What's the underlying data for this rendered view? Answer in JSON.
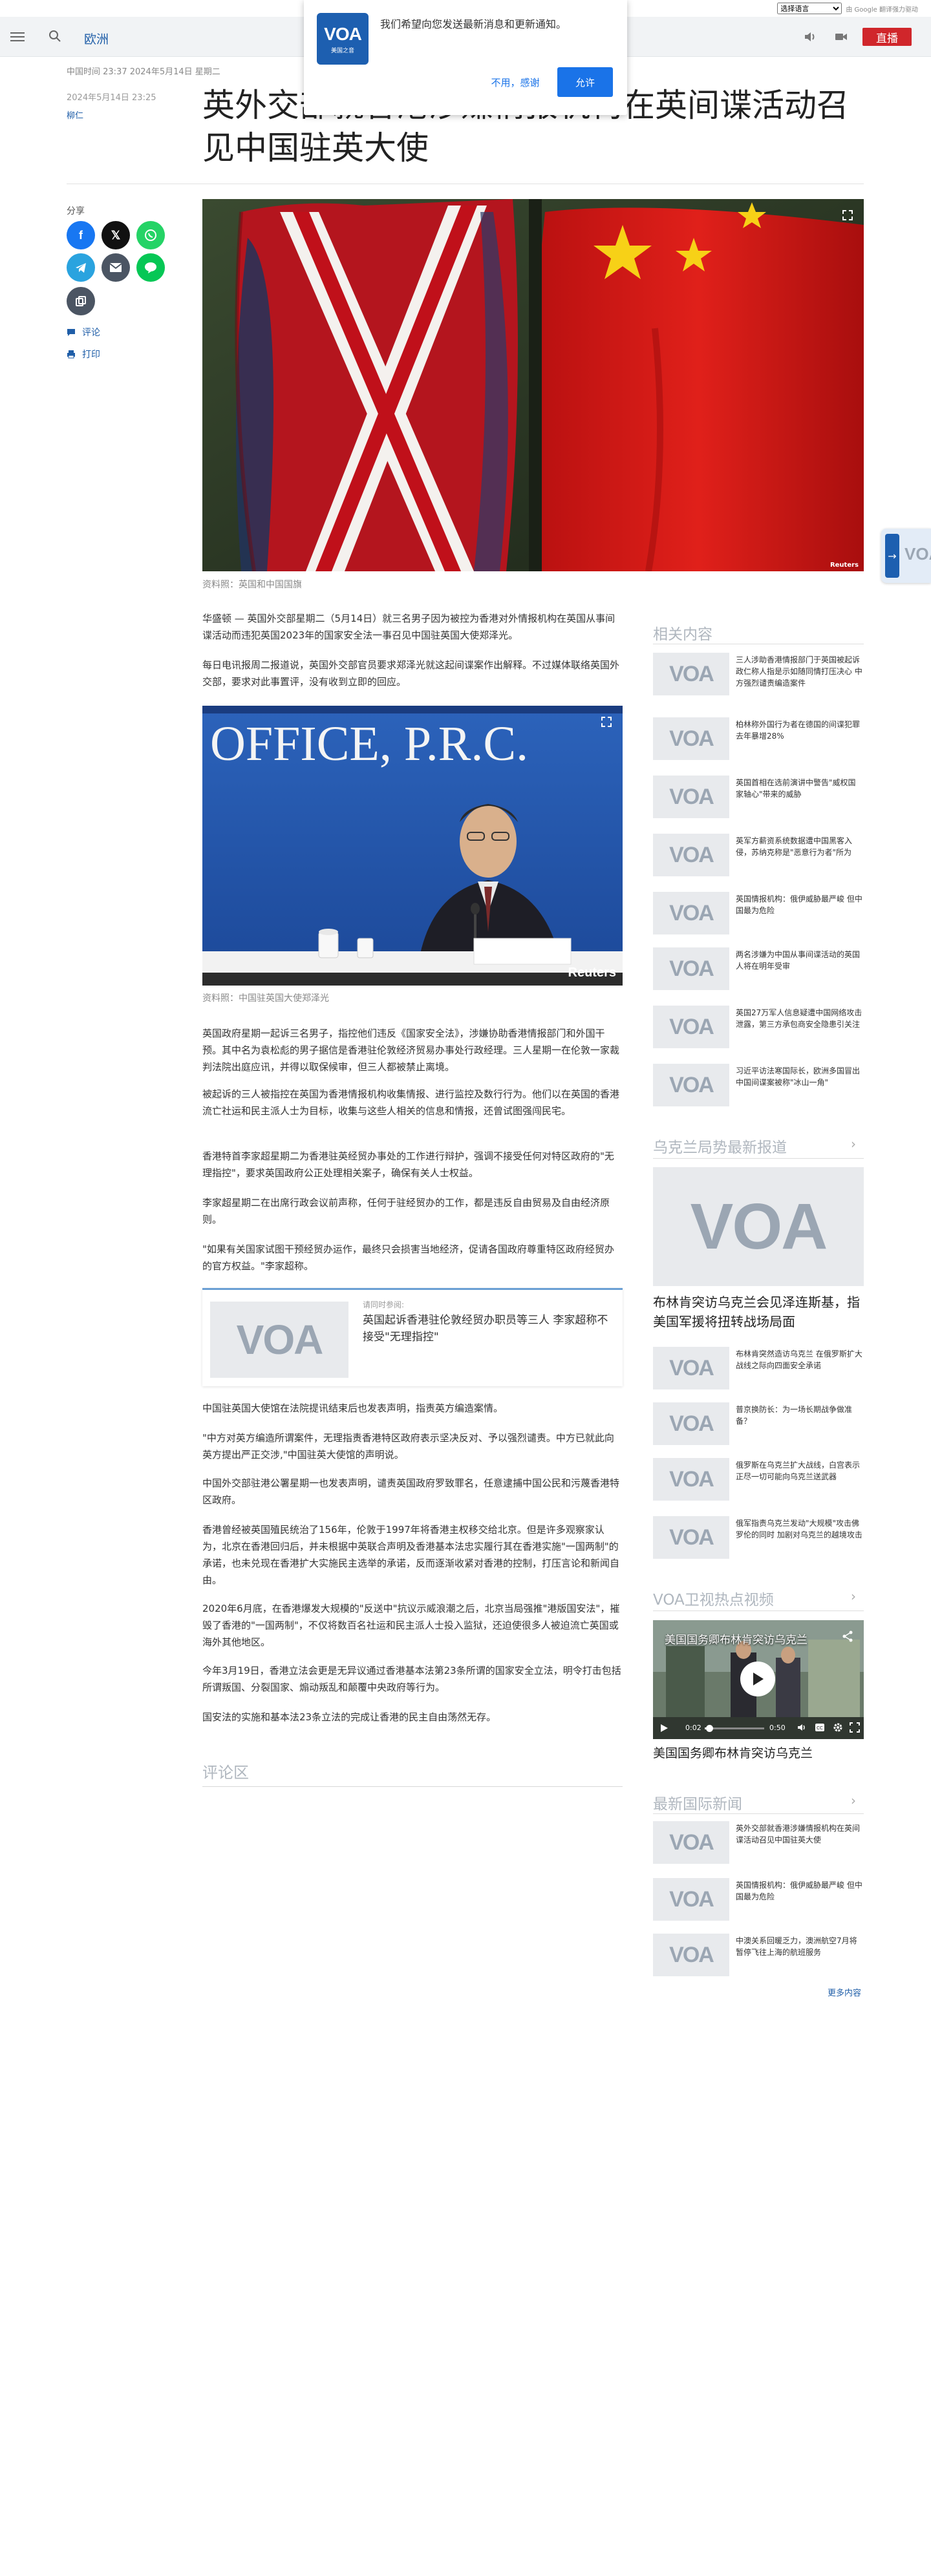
{
  "translate": {
    "select_label": "选择语言",
    "powered_by": "由 Google 翻译强力驱动"
  },
  "header": {
    "section": "欧洲",
    "live_label": "直播"
  },
  "notification": {
    "message": "我们希望向您发送最新消息和更新通知。",
    "deny_label": "不用，感谢",
    "allow_label": "允许",
    "logo_text": "VOA",
    "logo_sub": "美国之音"
  },
  "article": {
    "top_meta": "中国时间 23:37 2024年5月14日 星期二",
    "date": "2024年5月14日 23:25",
    "author": "柳仁",
    "title": "英外交部就香港涉嫌情报机构在英间谍活动召见中国驻英大使",
    "hero_caption": "资料照：英国和中国国旗",
    "hero_credit": "Reuters",
    "paragraphs_a": [
      "华盛顿 — 英国外交部星期二（5月14日）就三名男子因为被控为香港对外情报机构在英国从事间谍活动而违犯英国2023年的国家安全法一事召见中国驻英国大使郑泽光。",
      "每日电讯报周二报道说，英国外交部官员要求郑泽光就这起间谍案作出解释。不过媒体联络英国外交部，要求对此事置评，没有收到立即的回应。"
    ],
    "office_sign": "OFFICE, P.R.C.",
    "office_credit": "Reuters",
    "office_caption": "资料照：中国驻英国大使郑泽光",
    "paragraphs_b": [
      "英国政府星期一起诉三名男子，指控他们违反《国家安全法》，涉嫌协助香港情报部门和外国干预。其中名为袁松彪的男子据信是香港驻伦敦经济贸易办事处行政经理。三人星期一在伦敦一家裁判法院出庭应讯，并得以取保候审，但三人都被禁止离境。",
      "被起诉的三人被指控在英国为香港情报机构收集情报、进行监控及数行行为。他们以在英国的香港流亡社运和民主派人士为目标，收集与这些人相关的信息和情报，还曾试图强闯民宅。",
      "香港特首李家超星期二为香港驻英经贸办事处的工作进行辩护，强调不接受任何对特区政府的\"无理指控\"，要求英国政府公正处理相关案子，确保有关人士权益。",
      "李家超星期二在出席行政会议前声称，任何于驻经贸办的工作，都是违反自由贸易及自由经济原则。",
      "\"如果有关国家试图干预经贸办运作，最终只会损害当地经济，促请各国政府尊重特区政府经贸办的官方权益。\"李家超称。"
    ],
    "read_also_label": "请同时参阅:",
    "read_also_title": "英国起诉香港驻伦敦经贸办职员等三人 李家超称不接受\"无理指控\"",
    "paragraphs_c": [
      "中国驻英国大使馆在法院提讯结束后也发表声明，指责英方编造案情。",
      "\"中方对英方编造所谓案件，无理指责香港特区政府表示坚决反对、予以强烈谴责。中方已就此向英方提出严正交涉,\"中国驻英大使馆的声明说。",
      "中国外交部驻港公署星期一也发表声明，谴责英国政府罗致罪名，任意逮捕中国公民和污蔑香港特区政府。",
      "香港曾经被英国殖民统治了156年，伦敦于1997年将香港主权移交给北京。但是许多观察家认为，北京在香港回归后，并未根据中英联合声明及香港基本法忠实履行其在香港实施\"一国两制\"的承诺，也未兑现在香港扩大实施民主选举的承诺，反而逐渐收紧对香港的控制，打压言论和新闻自由。",
      "2020年6月底，在香港爆发大规模的\"反送中\"抗议示威浪潮之后，北京当局强推\"港版国安法\"，摧毁了香港的\"一国两制\"，不仅将数百名社运和民主派人士投入监狱，还迫使很多人被迫流亡英国或海外其他地区。",
      "今年3月19日，香港立法会更是无异议通过香港基本法第23条所谓的国家安全立法，明令打击包括所谓叛国、分裂国家、煽动叛乱和颠覆中央政府等行为。",
      "国安法的实施和基本法23条立法的完成让香港的民主自由荡然无存。"
    ],
    "comments_label": "评论区"
  },
  "share": {
    "label": "分享",
    "comments_link": "评论",
    "print_link": "打印",
    "colors": {
      "facebook": "#1877f2",
      "x": "#111111",
      "whatsapp": "#25d366",
      "telegram": "#2aa3df",
      "email": "#4b5563",
      "line": "#06c755",
      "copy": "#4b5563"
    }
  },
  "sidebar": {
    "related_title": "相关内容",
    "related": [
      "三人涉助香港情报部门于英国被起诉 政仁称人指是示如随同情打压决心 中方强烈谴责编造案件",
      "柏林称外国行为者在德国的间谍犯罪去年暴增28%",
      "英国首相在选前演讲中警告\"威权国家轴心\"带来的威胁",
      "英军方薪资系统数据遭中国黑客入侵，苏纳克称是\"恶意行为者\"所为",
      "英国情报机构：俄伊威胁最严峻 但中国最为危险",
      "两名涉嫌为中国从事间谍活动的英国人将在明年受审",
      "英国27万军人信息疑遭中国网络攻击泄露，第三方承包商安全隐患引关注",
      "习近平访法寒国际长，欧洲多国冒出中国间谍案被称\"冰山一角\""
    ],
    "ukraine_title": "乌克兰局势最新报道",
    "ukraine_feature": "布林肯突访乌克兰会见泽连斯基，指美国军援将扭转战场局面",
    "ukraine": [
      "布林肯突然造访乌克兰 在俄罗斯扩大战线之际向四面安全承诺",
      "普京换防长：为一场长期战争做准备？",
      "俄罗斯在乌克兰扩大战线，白宫表示正尽一切可能向乌克兰送武器",
      "俄军指责乌克兰发动\"大规模\"攻击佛罗伦的同时 加剧对乌克兰的越境攻击"
    ],
    "video_title": "VOA卫视热点视频",
    "video": {
      "overlay_title": "美国国务卿布林肯突访乌克兰",
      "time_current": "0:02",
      "time_total": "0:50",
      "caption": "美国国务卿布林肯突访乌克兰"
    },
    "latest_title": "最新国际新闻",
    "latest": [
      "英外交部就香港涉嫌情报机构在英间谍活动召见中国驻英大使",
      "英国情报机构：俄伊威胁最严峻 但中国最为危险",
      "中澳关系回暖乏力，澳洲航空7月将暂停飞往上海的航班服务"
    ],
    "more_label": "更多内容"
  },
  "float_tab": {
    "logo": "VOA"
  }
}
